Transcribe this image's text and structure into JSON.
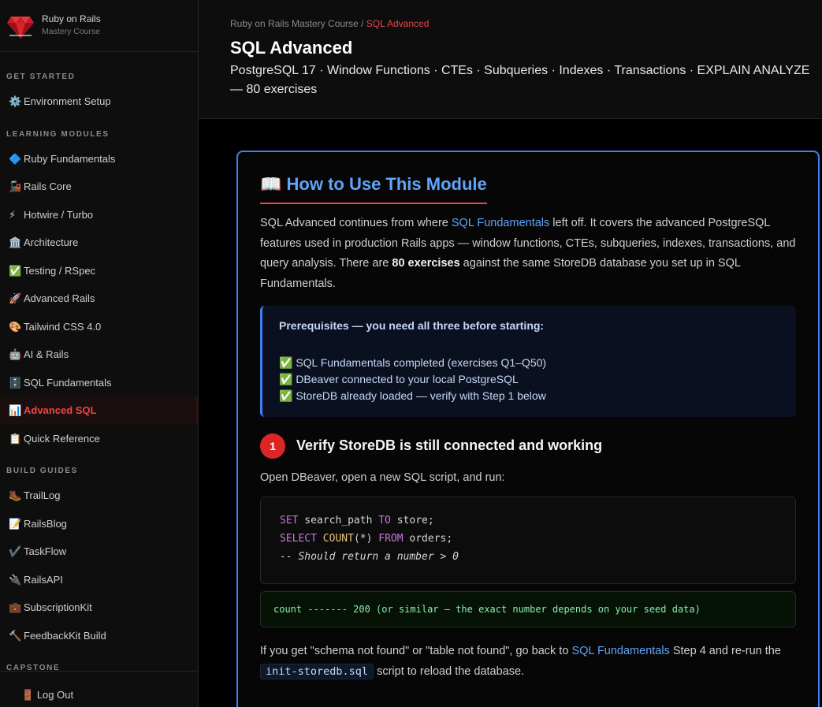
{
  "brand": {
    "title": "Ruby on Rails",
    "subtitle": "Mastery Course"
  },
  "sidebar": {
    "sections": {
      "get_started": "GET STARTED",
      "learning_modules": "LEARNING MODULES",
      "build_guides": "BUILD GUIDES",
      "capstone": "CAPSTONE"
    },
    "items": [
      {
        "emoji": "⚙️",
        "label": "Environment Setup"
      },
      {
        "emoji": "🔷",
        "label": "Ruby Fundamentals"
      },
      {
        "emoji": "🚂",
        "label": "Rails Core"
      },
      {
        "emoji": "⚡",
        "label": "Hotwire / Turbo"
      },
      {
        "emoji": "🏛️",
        "label": "Architecture"
      },
      {
        "emoji": "✅",
        "label": "Testing / RSpec"
      },
      {
        "emoji": "🚀",
        "label": "Advanced Rails"
      },
      {
        "emoji": "🎨",
        "label": "Tailwind CSS 4.0"
      },
      {
        "emoji": "🤖",
        "label": "AI & Rails"
      },
      {
        "emoji": "🗄️",
        "label": "SQL Fundamentals"
      },
      {
        "emoji": "📊",
        "label": "Advanced SQL"
      },
      {
        "emoji": "📋",
        "label": "Quick Reference"
      },
      {
        "emoji": "🥾",
        "label": "TrailLog"
      },
      {
        "emoji": "📝",
        "label": "RailsBlog"
      },
      {
        "emoji": "✔️",
        "label": "TaskFlow"
      },
      {
        "emoji": "🔌",
        "label": "RailsAPI"
      },
      {
        "emoji": "💼",
        "label": "SubscriptionKit"
      },
      {
        "emoji": "🔨",
        "label": "FeedbackKit Build"
      }
    ],
    "logout": {
      "emoji": "🚪",
      "label": "Log Out"
    }
  },
  "header": {
    "breadcrumb_parent": "Ruby on Rails Mastery Course",
    "breadcrumb_sep": " / ",
    "breadcrumb_current": "SQL Advanced",
    "title": "SQL Advanced",
    "subtitle": "PostgreSQL 17 · Window Functions · CTEs · Subqueries · Indexes · Transactions · EXPLAIN ANALYZE — 80 exercises"
  },
  "card": {
    "title_icon": "📖",
    "title": "How to Use This Module",
    "intro": {
      "p1": "SQL Advanced continues from where ",
      "link1": "SQL Fundamentals",
      "p2": " left off. It covers the advanced PostgreSQL features used in production Rails apps — window functions, CTEs, subqueries, indexes, transactions, and query analysis. There are ",
      "bold": "80 exercises",
      "p3": " against the same StoreDB database you set up in SQL Fundamentals."
    },
    "prereq": {
      "heading": "Prerequisites — you need all three before starting:",
      "items": [
        "✅ SQL Fundamentals completed (exercises Q1–Q50)",
        "✅ DBeaver connected to your local PostgreSQL",
        "✅ StoreDB already loaded — verify with Step 1 below"
      ]
    },
    "step": {
      "number": "1",
      "title": "Verify StoreDB is still connected and working",
      "desc": "Open DBeaver, open a new SQL script, and run:"
    },
    "code": {
      "l1_kw1": "SET",
      "l1_mid": " search_path ",
      "l1_kw2": "TO",
      "l1_end": " store;",
      "l2_kw1": "SELECT",
      "l2_fn": " COUNT",
      "l2_mid": "(*) ",
      "l2_kw2": "FROM",
      "l2_end": " orders;",
      "l3_comment": "-- Should return a number > 0"
    },
    "output": "count ------- 200 (or similar — the exact number depends on your seed data)",
    "footer": {
      "p1": "If you get \"schema not found\" or \"table not found\", go back to ",
      "link": "SQL Fundamentals",
      "p2": " Step 4 and re-run the ",
      "code": "init-storedb.sql",
      "p3": " script to reload the database."
    }
  }
}
